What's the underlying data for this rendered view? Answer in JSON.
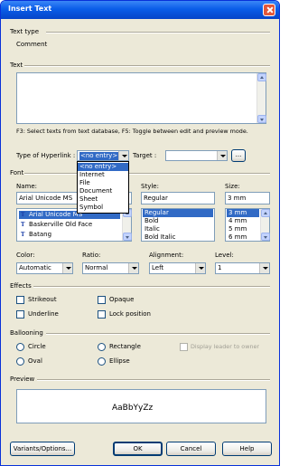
{
  "window": {
    "title": "Insert Text"
  },
  "text_type": {
    "label": "Text type",
    "value": "Comment"
  },
  "text_section": {
    "label": "Text",
    "hint": "F3: Select texts from text database, F5: Toggle between edit and preview mode."
  },
  "hyperlink": {
    "label": "Type of Hyperlink :",
    "value": "<no entry>",
    "options": [
      "<no entry>",
      "Internet",
      "File",
      "Document",
      "Sheet",
      "Symbol"
    ],
    "target_label": "Target :",
    "target_value": "",
    "browse_label": "..."
  },
  "font": {
    "section_label": "Font",
    "name_label": "Name:",
    "name_value": "Arial Unicode MS",
    "name_list": [
      "Arial Unicode MS",
      "Baskerville Old Face",
      "Batang"
    ],
    "style_label": "Style:",
    "style_value": "Regular",
    "style_list": [
      "Regular",
      "Bold",
      "Italic",
      "Bold Italic"
    ],
    "size_label": "Size:",
    "size_value": "3 mm",
    "size_list": [
      "3 mm",
      "4 mm",
      "5 mm",
      "6 mm"
    ],
    "color_label": "Color:",
    "color_value": "Automatic",
    "ratio_label": "Ratio:",
    "ratio_value": "Normal",
    "alignment_label": "Alignment:",
    "alignment_value": "Left",
    "level_label": "Level:",
    "level_value": "1"
  },
  "effects": {
    "section_label": "Effects",
    "strikeout": "Strikeout",
    "opaque": "Opaque",
    "underline": "Underline",
    "lock_position": "Lock position"
  },
  "ballooning": {
    "section_label": "Ballooning",
    "circle": "Circle",
    "rectangle": "Rectangle",
    "display_leader": "Display leader to owner",
    "oval": "Oval",
    "ellipse": "Ellipse"
  },
  "preview": {
    "section_label": "Preview",
    "sample": "AaBbYyZz"
  },
  "buttons": {
    "variants": "Variants/Options...",
    "ok": "OK",
    "cancel": "Cancel",
    "help": "Help"
  },
  "colors": {
    "title_bar": "#0a5de8",
    "selection": "#316ac5",
    "dialog_bg": "#ece9d8"
  }
}
